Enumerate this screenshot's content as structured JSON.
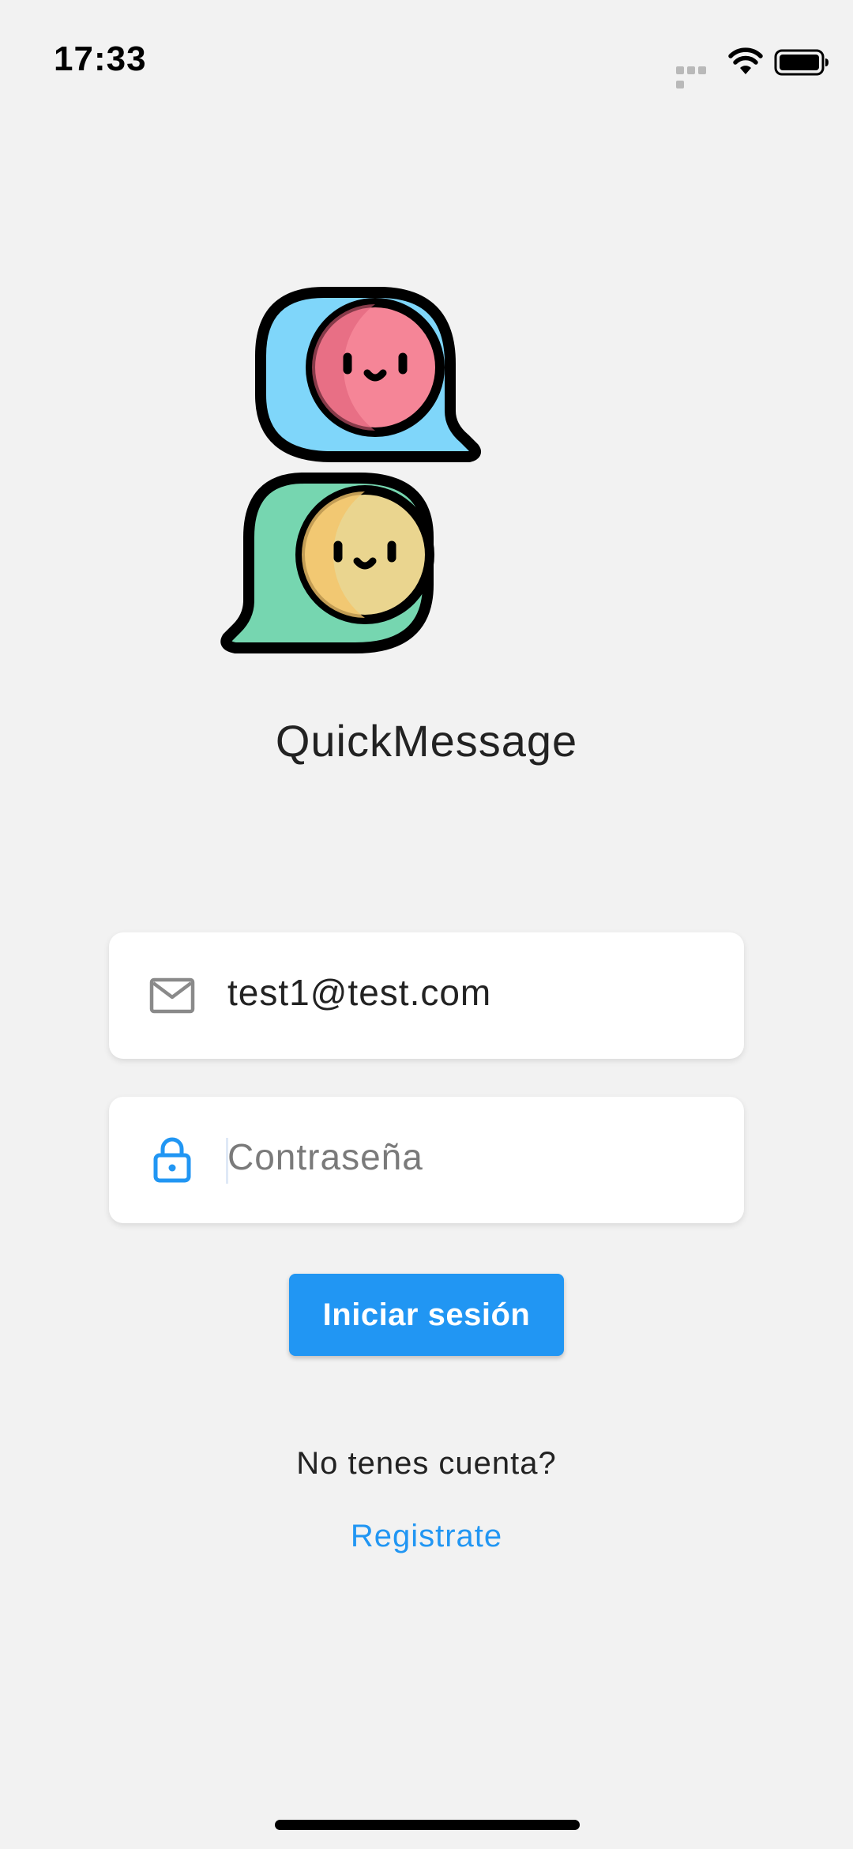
{
  "status_bar": {
    "time": "17:33"
  },
  "app": {
    "title": "QuickMessage",
    "logo": "chat-bubbles-logo"
  },
  "login_form": {
    "email": {
      "value": "test1@test.com",
      "icon": "mail-icon"
    },
    "password": {
      "placeholder": "Contraseña",
      "icon": "lock-icon"
    },
    "submit_label": "Iniciar sesión"
  },
  "footer": {
    "prompt": "No tenes cuenta?",
    "register_label": "Registrate"
  },
  "colors": {
    "accent": "#2196f3",
    "background": "#f2f2f2",
    "bubble_blue": "#7fd6fa",
    "bubble_green": "#76d6b0",
    "face_pink": "#f58597",
    "face_yellow": "#ead58f"
  }
}
